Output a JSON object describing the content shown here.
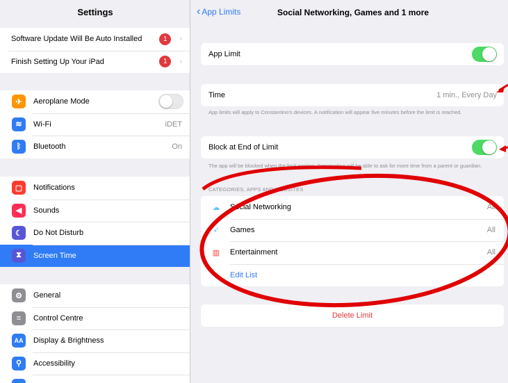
{
  "sidebar": {
    "title": "Settings",
    "alerts": [
      {
        "label": "Software Update Will Be Auto Installed",
        "badge": "1"
      },
      {
        "label": "Finish Setting Up Your iPad",
        "badge": "1"
      }
    ],
    "connectivity": [
      {
        "label": "Aeroplane Mode",
        "icon": "airplane-icon",
        "color": "#ff9500",
        "glyph": "✈"
      },
      {
        "label": "Wi-Fi",
        "icon": "wifi-icon",
        "color": "#2f7cf6",
        "glyph": "≋",
        "value": "iDET"
      },
      {
        "label": "Bluetooth",
        "icon": "bluetooth-icon",
        "color": "#2f7cf6",
        "glyph": "ᛒ",
        "value": "On"
      }
    ],
    "system": [
      {
        "label": "Notifications",
        "icon": "notifications-icon",
        "color": "#ff3b30",
        "glyph": "▢"
      },
      {
        "label": "Sounds",
        "icon": "speaker-icon",
        "color": "#ff2d55",
        "glyph": "◀"
      },
      {
        "label": "Do Not Disturb",
        "icon": "moon-icon",
        "color": "#5856d6",
        "glyph": "☾"
      },
      {
        "label": "Screen Time",
        "icon": "hourglass-icon",
        "color": "#5856d6",
        "glyph": "⧗"
      }
    ],
    "general": [
      {
        "label": "General",
        "icon": "gear-icon",
        "color": "#8e8e93",
        "glyph": "⚙"
      },
      {
        "label": "Control Centre",
        "icon": "switches-icon",
        "color": "#8e8e93",
        "glyph": "≡"
      },
      {
        "label": "Display & Brightness",
        "icon": "display-icon",
        "color": "#2f7cf6",
        "glyph": "AA"
      },
      {
        "label": "Accessibility",
        "icon": "accessibility-icon",
        "color": "#2f7cf6",
        "glyph": "⚲"
      }
    ]
  },
  "detail": {
    "back_label": "App Limits",
    "title": "Social Networking, Games and 1 more",
    "app_limit_label": "App Limit",
    "time_label": "Time",
    "time_value": "1 min., Every Day",
    "time_note": "App limits will apply to Constantino's devices. A notification will appear five minutes before the limit is reached.",
    "block_label": "Block at End of Limit",
    "block_note": "The app will be blocked when the limit expires. Constantino will be able to ask for more time from a parent or guardian.",
    "section_header": "CATEGORIES, APPS AND WEBSITES",
    "categories": [
      {
        "label": "Social Networking",
        "value": "All",
        "icon": "social-networking-icon",
        "glyph": "☁",
        "color": "#5ac8fa"
      },
      {
        "label": "Games",
        "value": "All",
        "icon": "rocket-icon",
        "glyph": "🚀",
        "color": "#5ac8fa"
      },
      {
        "label": "Entertainment",
        "value": "All",
        "icon": "popcorn-icon",
        "glyph": "🍿",
        "color": "#ff3b30"
      }
    ],
    "edit_list": "Edit List",
    "delete_limit": "Delete Limit"
  },
  "colors": {
    "accent": "#2f7cf6",
    "toggle_on": "#4cd964",
    "destructive": "#e0393e",
    "annotation": "#e00000"
  }
}
